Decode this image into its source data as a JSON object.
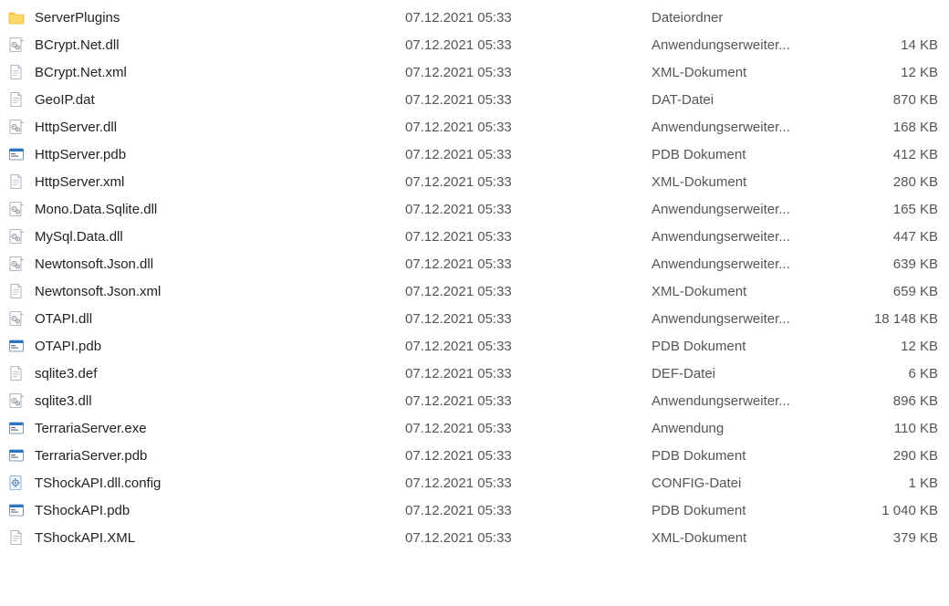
{
  "files": [
    {
      "icon": "folder",
      "name": "ServerPlugins",
      "date": "07.12.2021 05:33",
      "type": "Dateiordner",
      "size": ""
    },
    {
      "icon": "dll",
      "name": "BCrypt.Net.dll",
      "date": "07.12.2021 05:33",
      "type": "Anwendungserweiter...",
      "size": "14 KB"
    },
    {
      "icon": "document",
      "name": "BCrypt.Net.xml",
      "date": "07.12.2021 05:33",
      "type": "XML-Dokument",
      "size": "12 KB"
    },
    {
      "icon": "document",
      "name": "GeoIP.dat",
      "date": "07.12.2021 05:33",
      "type": "DAT-Datei",
      "size": "870 KB"
    },
    {
      "icon": "dll",
      "name": "HttpServer.dll",
      "date": "07.12.2021 05:33",
      "type": "Anwendungserweiter...",
      "size": "168 KB"
    },
    {
      "icon": "pdb",
      "name": "HttpServer.pdb",
      "date": "07.12.2021 05:33",
      "type": "PDB Dokument",
      "size": "412 KB"
    },
    {
      "icon": "document",
      "name": "HttpServer.xml",
      "date": "07.12.2021 05:33",
      "type": "XML-Dokument",
      "size": "280 KB"
    },
    {
      "icon": "dll",
      "name": "Mono.Data.Sqlite.dll",
      "date": "07.12.2021 05:33",
      "type": "Anwendungserweiter...",
      "size": "165 KB"
    },
    {
      "icon": "dll",
      "name": "MySql.Data.dll",
      "date": "07.12.2021 05:33",
      "type": "Anwendungserweiter...",
      "size": "447 KB"
    },
    {
      "icon": "dll",
      "name": "Newtonsoft.Json.dll",
      "date": "07.12.2021 05:33",
      "type": "Anwendungserweiter...",
      "size": "639 KB"
    },
    {
      "icon": "document",
      "name": "Newtonsoft.Json.xml",
      "date": "07.12.2021 05:33",
      "type": "XML-Dokument",
      "size": "659 KB"
    },
    {
      "icon": "dll",
      "name": "OTAPI.dll",
      "date": "07.12.2021 05:33",
      "type": "Anwendungserweiter...",
      "size": "18 148 KB"
    },
    {
      "icon": "pdb",
      "name": "OTAPI.pdb",
      "date": "07.12.2021 05:33",
      "type": "PDB Dokument",
      "size": "12 KB"
    },
    {
      "icon": "document",
      "name": "sqlite3.def",
      "date": "07.12.2021 05:33",
      "type": "DEF-Datei",
      "size": "6 KB"
    },
    {
      "icon": "dll",
      "name": "sqlite3.dll",
      "date": "07.12.2021 05:33",
      "type": "Anwendungserweiter...",
      "size": "896 KB"
    },
    {
      "icon": "exe",
      "name": "TerrariaServer.exe",
      "date": "07.12.2021 05:33",
      "type": "Anwendung",
      "size": "110 KB"
    },
    {
      "icon": "pdb",
      "name": "TerrariaServer.pdb",
      "date": "07.12.2021 05:33",
      "type": "PDB Dokument",
      "size": "290 KB"
    },
    {
      "icon": "config",
      "name": "TShockAPI.dll.config",
      "date": "07.12.2021 05:33",
      "type": "CONFIG-Datei",
      "size": "1 KB"
    },
    {
      "icon": "pdb",
      "name": "TShockAPI.pdb",
      "date": "07.12.2021 05:33",
      "type": "PDB Dokument",
      "size": "1 040 KB"
    },
    {
      "icon": "document",
      "name": "TShockAPI.XML",
      "date": "07.12.2021 05:33",
      "type": "XML-Dokument",
      "size": "379 KB"
    }
  ]
}
